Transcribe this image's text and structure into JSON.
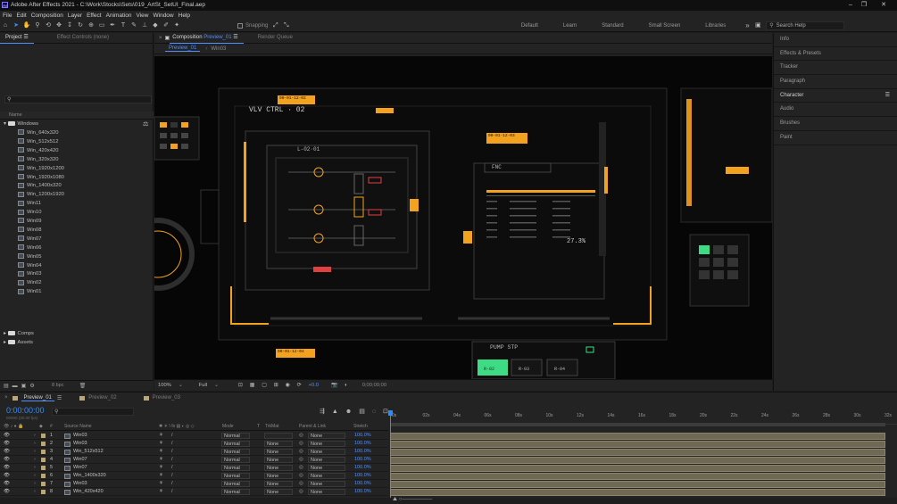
{
  "titlebar": {
    "title": "Adobe After Effects 2021 - C:\\Work\\Stocks\\Sets\\019_ArtSt_SetUI_Final.aep",
    "app_logo": "Ae"
  },
  "menu": [
    "File",
    "Edit",
    "Composition",
    "Layer",
    "Effect",
    "Animation",
    "View",
    "Window",
    "Help"
  ],
  "toolbar": {
    "snapping_label": "Snapping",
    "workspaces": [
      "Default",
      "Learn",
      "Standard",
      "Small Screen",
      "Libraries"
    ],
    "search_placeholder": "Search Help",
    "overflow": "»"
  },
  "project": {
    "tab": "Project",
    "effect_controls": "Effect Controls (none)",
    "column_name": "Name",
    "folder_root": "Windows",
    "items": [
      "Win_640x320",
      "Win_512x512",
      "Win_420x420",
      "Win_320x320",
      "Win_1920x1200",
      "Win_1920x1080",
      "Win_1400x320",
      "Win_1200x1920",
      "Win11",
      "Win10",
      "Win09",
      "Win08",
      "Win07",
      "Win06",
      "Win05",
      "Win04",
      "Win03",
      "Win02",
      "Win01"
    ],
    "folders_bottom": [
      "Comps",
      "Assets"
    ],
    "bpc": "8 bpc"
  },
  "composition": {
    "tab_label": "Composition",
    "tab_name": "Preview_01",
    "render_queue": "Render Queue",
    "breadcrumbs": [
      "Preview_01",
      "Win03"
    ],
    "zoom": "100%",
    "resolution": "Full",
    "exposure": "+0.0",
    "timecode": "0;00;00;00"
  },
  "hud": {
    "vlv_ctrl": "VLV CTRL · 02",
    "l_02": "L-02·01",
    "fnc": "FNC",
    "percent": "27.3%",
    "pump": "PUMP STP",
    "r02": "R-02",
    "r03": "R-03",
    "r04": "R-04",
    "tag1": "00-01-12-02",
    "tag2": "00-01-12-03",
    "tag3": "00-01-12-04",
    "accent": "#f2a21f",
    "green": "#3ddc84"
  },
  "right_panels": [
    "Info",
    "Effects & Presets",
    "Tracker",
    "Paragraph",
    "Character",
    "Audio",
    "Brushes",
    "Paint"
  ],
  "timeline": {
    "tabs": [
      "Preview_01",
      "Preview_02",
      "Preview_03"
    ],
    "timecode": "0:00:00:00",
    "fps": "00000 (30.00 fps)",
    "headers": {
      "source": "Source Name",
      "mode": "Mode",
      "t": "T",
      "trkmat": "TrkMat",
      "parent": "Parent & Link",
      "stretch": "Stretch"
    },
    "ruler": [
      "0s",
      "02s",
      "04s",
      "06s",
      "08s",
      "10s",
      "12s",
      "14s",
      "16s",
      "18s",
      "20s",
      "22s",
      "24s",
      "26s",
      "28s",
      "30s",
      "32s"
    ],
    "layers": [
      {
        "num": "1",
        "name": "Win03",
        "mode": "Normal",
        "trkmat": "",
        "parent": "None",
        "stretch": "100.0%"
      },
      {
        "num": "2",
        "name": "Win03",
        "mode": "Normal",
        "trkmat": "None",
        "parent": "None",
        "stretch": "100.0%"
      },
      {
        "num": "3",
        "name": "Win_512x512",
        "mode": "Normal",
        "trkmat": "None",
        "parent": "None",
        "stretch": "100.0%"
      },
      {
        "num": "4",
        "name": "Win07",
        "mode": "Normal",
        "trkmat": "None",
        "parent": "None",
        "stretch": "100.0%"
      },
      {
        "num": "5",
        "name": "Win07",
        "mode": "Normal",
        "trkmat": "None",
        "parent": "None",
        "stretch": "100.0%"
      },
      {
        "num": "6",
        "name": "Win_1400x320",
        "mode": "Normal",
        "trkmat": "None",
        "parent": "None",
        "stretch": "100.0%"
      },
      {
        "num": "7",
        "name": "Win03",
        "mode": "Normal",
        "trkmat": "None",
        "parent": "None",
        "stretch": "100.0%"
      },
      {
        "num": "8",
        "name": "Win_420x420",
        "mode": "Normal",
        "trkmat": "None",
        "parent": "None",
        "stretch": "100.0%"
      }
    ]
  }
}
